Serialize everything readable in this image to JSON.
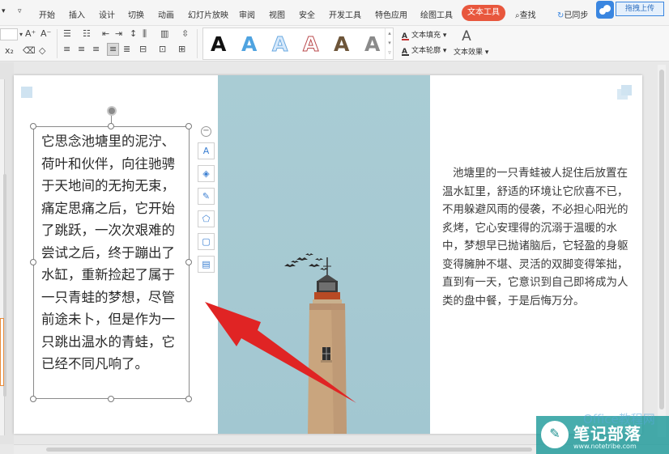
{
  "menu": {
    "items": [
      "开始",
      "插入",
      "设计",
      "切换",
      "动画",
      "幻灯片放映",
      "审阅",
      "视图",
      "安全",
      "开发工具",
      "特色应用",
      "绘图工具"
    ],
    "active_tab": "文本工具",
    "search": "查找",
    "sync": "已同步",
    "upload": "拖拽上传"
  },
  "ribbon": {
    "font_grow": "A⁺",
    "font_shrink": "A⁻",
    "art_glyph": "A",
    "text_fill": "文本填充",
    "text_outline": "文本轮廓",
    "text_effect": "文本效果",
    "effect_glyph": "A",
    "colors": {
      "fill_underline": "#c23232",
      "active_tab_bg": "#e8573d"
    }
  },
  "slide": {
    "textbox_text": "它思念池塘里的泥泞、荷叶和伙伴，向往驰骋于天地间的无拘无束，痛定思痛之后，它开始了跳跃，一次次艰难的尝试之后，终于蹦出了水缸，重新捡起了属于一只青蛙的梦想，尽管前途未卜，但是作为一只跳出温水的青蛙，它已经不同凡响了。",
    "right_text": "池塘里的一只青蛙被人捉住后放置在温水缸里，舒适的环境让它欣喜不已，不用躲避风雨的侵袭，不必担心阳光的炙烤，它心安理得的沉溺于温暖的水中，梦想早已抛诸脑后，它轻盈的身躯变得臃肿不堪、灵活的双脚变得笨拙，直到有一天，它意识到自己即将成为人类的盘中餐，于是后悔万分。",
    "photo_bg": "#a8cbd3",
    "arrow_color": "#e02424"
  },
  "float_toolbar": {
    "collapse": "−",
    "buttons": [
      "A",
      "◈",
      "✎",
      "⬠",
      "▢",
      "▤"
    ]
  },
  "watermark": {
    "name": "笔记部落",
    "url": "www.notetribe.com",
    "faint": "Office教程网"
  }
}
